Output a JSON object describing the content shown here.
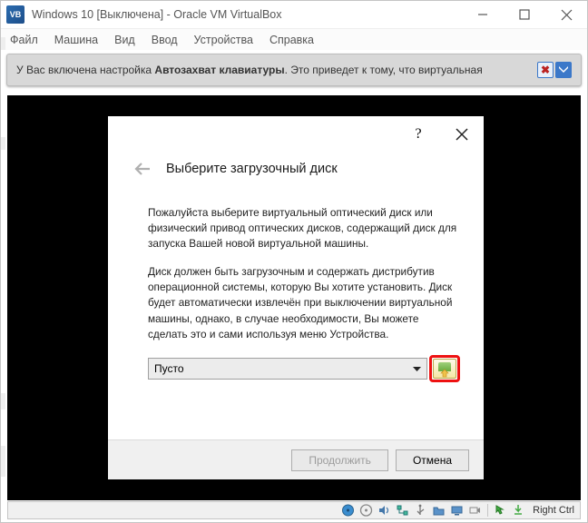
{
  "window": {
    "title": "Windows 10 [Выключена] - Oracle VM VirtualBox",
    "menu": [
      "Файл",
      "Машина",
      "Вид",
      "Ввод",
      "Устройства",
      "Справка"
    ]
  },
  "notice": {
    "prefix": "У Вас включена настройка ",
    "bold": "Автозахват клавиатуры",
    "suffix": ". Это приведет к тому, что виртуальная"
  },
  "dialog": {
    "title": "Выберите загрузочный диск",
    "para1": "Пожалуйста выберите виртуальный оптический диск или физический привод оптических дисков, содержащий диск для запуска Вашей новой виртуальной машины.",
    "para2": "Диск должен быть загрузочным и содержать дистрибутив операционной системы, которую Вы хотите установить. Диск будет автоматически извлечён при выключении виртуальной машины, однако, в случае необходимости, Вы можете сделать это и сами используя меню Устройства.",
    "select_value": "Пусто",
    "continue": "Продолжить",
    "cancel": "Отмена"
  },
  "statusbar": {
    "host_key": "Right Ctrl"
  }
}
